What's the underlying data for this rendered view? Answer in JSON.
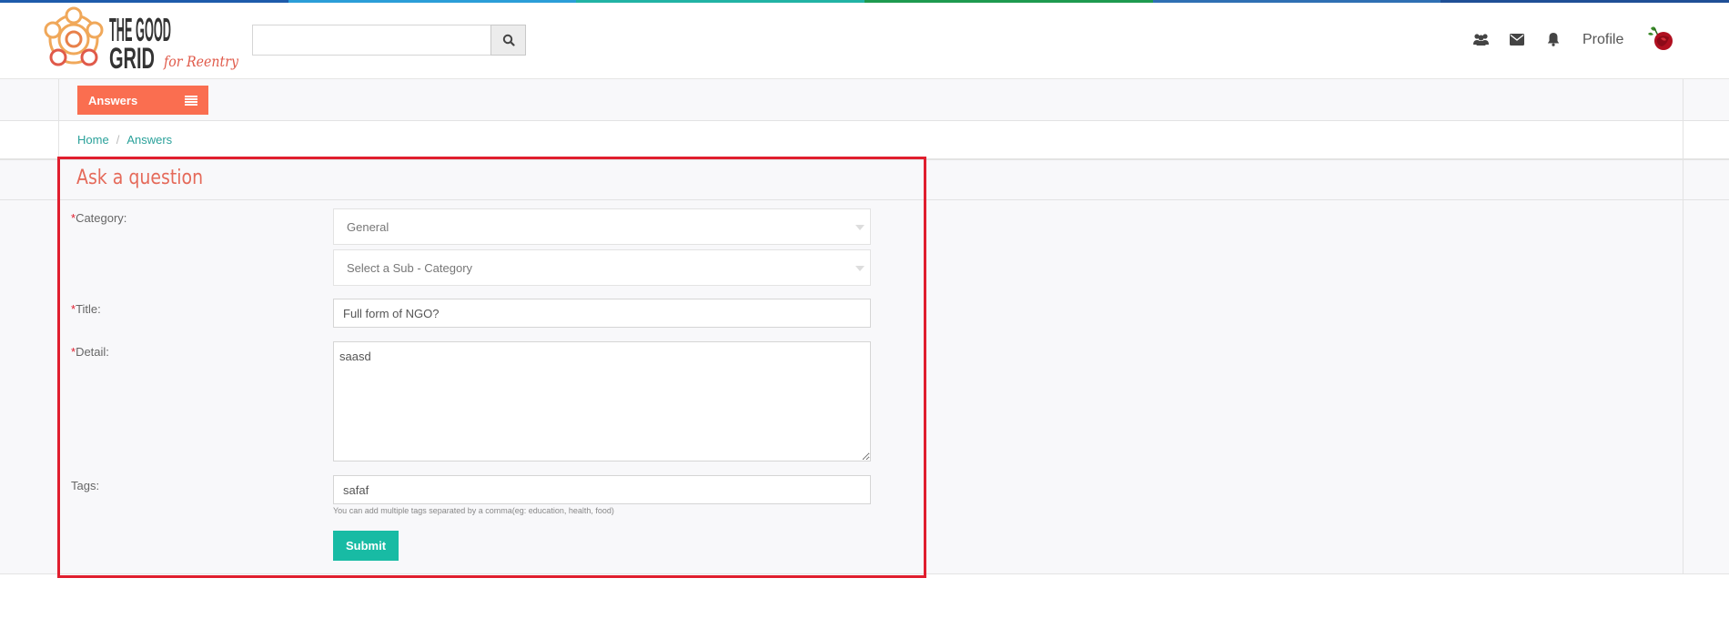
{
  "colors": {
    "stripe": [
      "#1e5bab",
      "#2b9ed8",
      "#22b3a5",
      "#1e9a4f",
      "#2e6fb3",
      "#1f4f96"
    ],
    "accent": "#fa6e50",
    "link": "#2aa19a",
    "title": "#e56a5a",
    "submit": "#18bba4",
    "highlight": "#e01e2e"
  },
  "header": {
    "logo_text_line1": "THE GOOD",
    "logo_text_line2": "GRID",
    "logo_tagline": "for Reentry",
    "search": {
      "value": "",
      "placeholder": ""
    },
    "icons": [
      "users-icon",
      "envelope-icon",
      "bell-icon",
      "search-icon"
    ],
    "profile_label": "Profile"
  },
  "subnav": {
    "answers_label": "Answers"
  },
  "breadcrumb": {
    "home": "Home",
    "separator": "/",
    "current": "Answers"
  },
  "form": {
    "title": "Ask a question",
    "required_mark": "*",
    "category_label": "Category:",
    "category_value": "General",
    "subcategory_value": "Select a Sub - Category",
    "title_label": "Title:",
    "title_value": "Full form of NGO?",
    "detail_label": "Detail:",
    "detail_value": "saasd",
    "tags_label": "Tags:",
    "tags_value": "safaf",
    "tags_help": "You can add multiple tags separated by a comma(eg: education, health, food)",
    "submit_label": "Submit"
  }
}
